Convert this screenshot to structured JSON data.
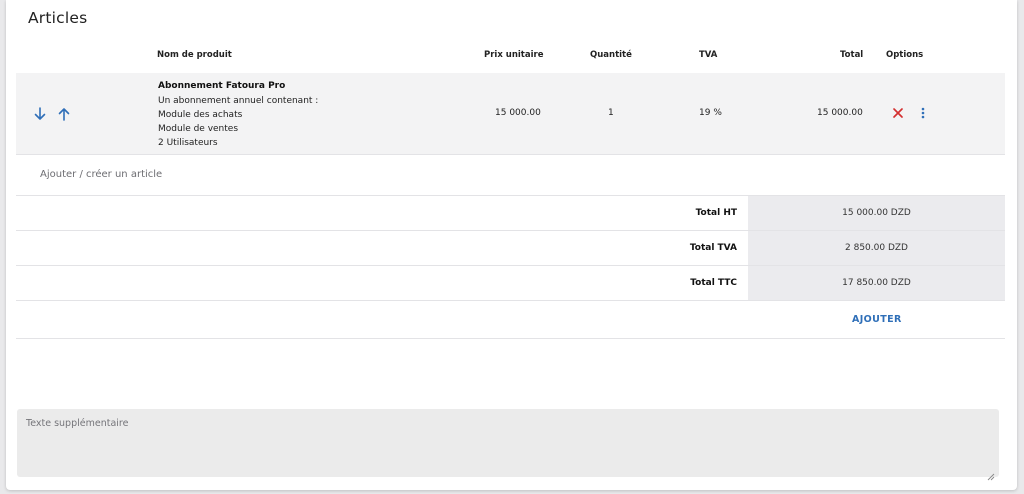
{
  "section": {
    "title": "Articles"
  },
  "columns": {
    "product": "Nom de produit",
    "unit_price": "Prix unitaire",
    "quantity": "Quantité",
    "tva": "TVA",
    "total": "Total",
    "options": "Options"
  },
  "items": [
    {
      "name": "Abonnement Fatoura Pro",
      "description": [
        "Un abonnement annuel contenant :",
        "Module des achats",
        "Module de ventes",
        "2 Utilisateurs"
      ],
      "unit_price": "15 000.00",
      "quantity": "1",
      "tva": "19 %",
      "total": "15 000.00",
      "icons": {
        "move_down": "arrow-down-icon",
        "move_up": "arrow-up-icon",
        "remove": "close-icon",
        "more": "kebab-menu-icon"
      }
    }
  ],
  "add_article": {
    "placeholder": "Ajouter / créer un article"
  },
  "totals": [
    {
      "label": "Total HT",
      "value": "15 000.00 DZD"
    },
    {
      "label": "Total TVA",
      "value": "2 850.00 DZD"
    },
    {
      "label": "Total TTC",
      "value": "17 850.00 DZD"
    }
  ],
  "add_button": {
    "label": "AJOUTER"
  },
  "extra_text": {
    "placeholder": "Texte supplémentaire"
  },
  "colors": {
    "accent": "#2f6fb8",
    "danger": "#d32f2f",
    "row_bg": "#f3f3f4",
    "total_bg": "#ebebee"
  }
}
